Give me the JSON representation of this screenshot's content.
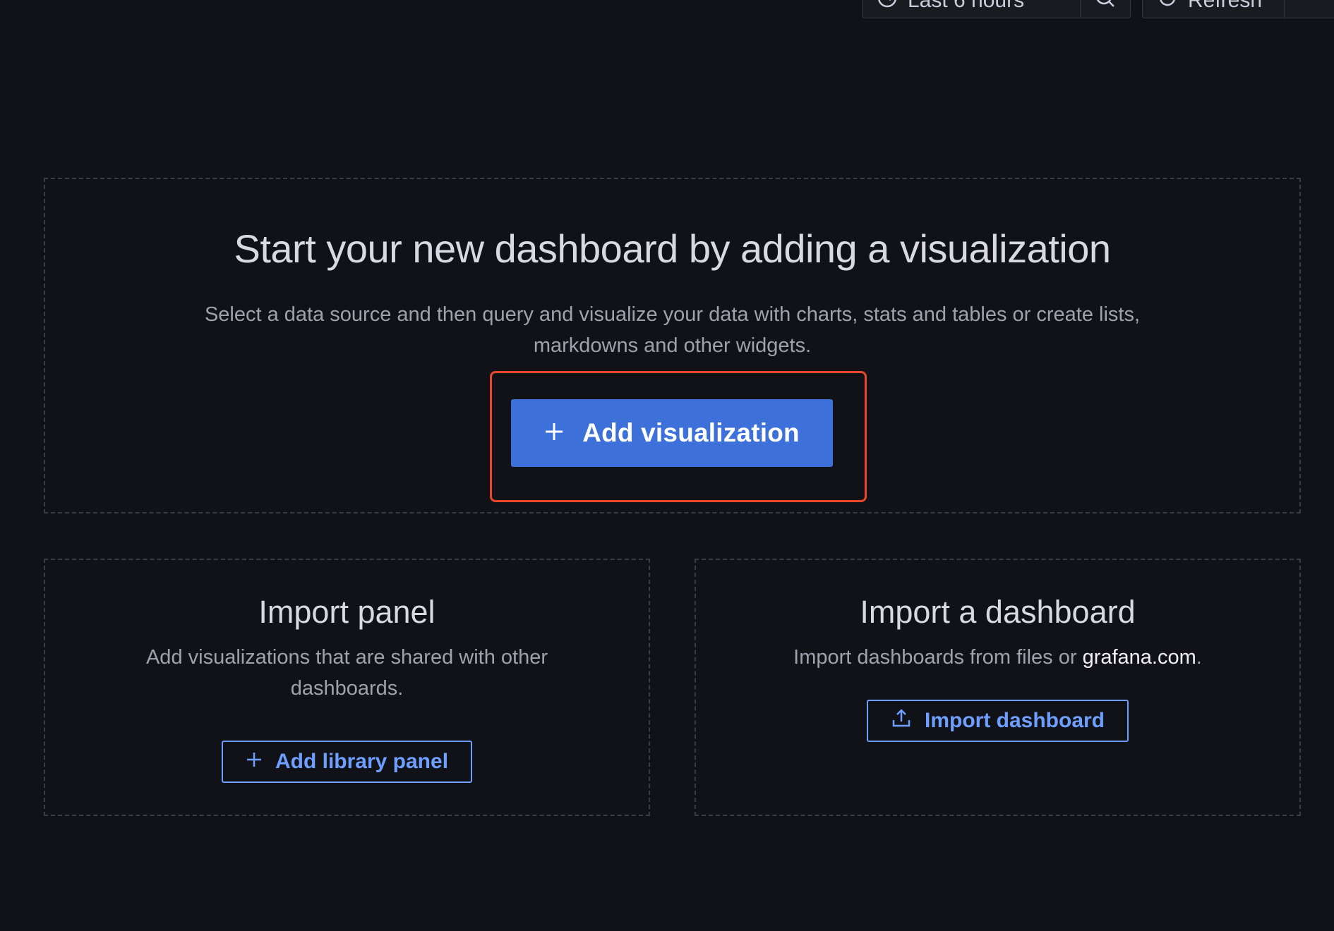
{
  "toolbar": {
    "time_range_label": "Last 6 hours",
    "time_icon": "clock-icon",
    "zoom_icon": "zoom-out-icon",
    "refresh_label": "Refresh",
    "refresh_icon": "refresh-icon"
  },
  "empty_state": {
    "title": "Start your new dashboard by adding a visualization",
    "description": "Select a data source and then query and visualize your data with charts, stats and tables or create lists, markdowns and other widgets.",
    "add_visualization_label": "Add visualization",
    "add_icon": "plus-icon"
  },
  "import_panel": {
    "title": "Import panel",
    "description": "Add visualizations that are shared with other dashboards.",
    "button_label": "Add library panel",
    "button_icon": "plus-icon"
  },
  "import_dashboard": {
    "title": "Import a dashboard",
    "description_prefix": "Import dashboards from files or ",
    "link_text": "grafana.com",
    "description_suffix": ".",
    "button_label": "Import dashboard",
    "button_icon": "upload-icon"
  },
  "colors": {
    "background": "#111217",
    "primary_button": "#3d71d9",
    "outline_button": "#6e9fff",
    "highlight_border": "#e8472c",
    "dashed_border": "#3b3d45"
  }
}
